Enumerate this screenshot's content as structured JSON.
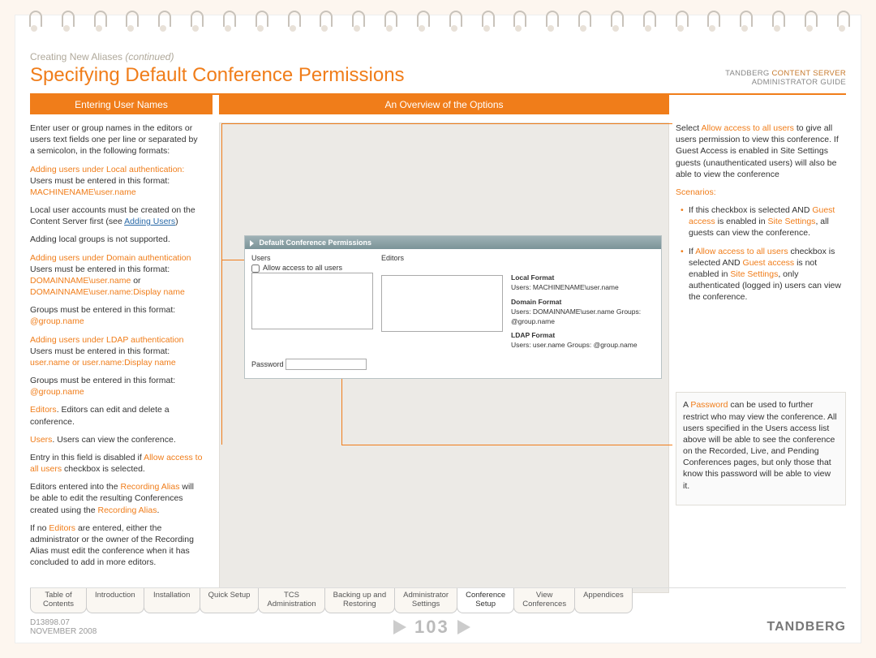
{
  "breadcrumb_main": "Creating New Aliases",
  "breadcrumb_cont": "(continued)",
  "title": "Specifying Default Conference Permissions",
  "doc_line1a": "TANDBERG",
  "doc_line1b": "CONTENT SERVER",
  "doc_line2": "ADMINISTRATOR GUIDE",
  "sh_left": "Entering User Names",
  "sh_mid": "An Overview of the Options",
  "left": {
    "p1": "Enter user or group names in the editors or users text fields one per line or separated by a semicolon, in the following formats:",
    "h1": "Adding users under Local authentication:",
    "p2": "Users must be entered in this format:",
    "f1": "MACHINENAME\\user.name",
    "p3a": "Local user accounts must be created on the Content Server first (see ",
    "p3b": "Adding Users",
    "p3c": ")",
    "p4": "Adding local groups is not supported.",
    "h2": "Adding users under Domain authentication",
    "p5a": "Users must be entered in this format: ",
    "p5b": "DOMAINNAME\\user.name",
    "p5c": " or ",
    "p5d": "DOMAINNAME\\user.name:Display name",
    "p6a": "Groups must be entered in this format: ",
    "p6b": "@group.name",
    "h3": "Adding users under LDAP authentication",
    "p7a": "Users must be entered in this format: ",
    "p7b": "user.name or user.name:Display name",
    "p8a": "Groups must be entered in this format: ",
    "p8b": "@group.name",
    "p9a": "Editors",
    "p9b": ". Editors can edit and delete a conference.",
    "p10a": "Users",
    "p10b": ". Users can view the conference.",
    "p11a": "Entry in this field is disabled if ",
    "p11b": "Allow access to all users",
    "p11c": " checkbox is selected.",
    "p12a": "Editors entered into the ",
    "p12b": "Recording Alias",
    "p12c": " will be able to edit the resulting Conferences created using the ",
    "p12d": "Recording Alias",
    "p12e": ".",
    "p13a": "If no ",
    "p13b": "Editors",
    "p13c": " are entered, either the administrator or the owner of the Recording Alias must edit the conference when it has concluded to add in more editors."
  },
  "right": {
    "p1a": "Select ",
    "p1b": "Allow access to all users",
    "p1c": " to give all users permission to view this conference. If Guest Access is enabled in Site Settings guests (unauthenticated users) will also be able to view the conference",
    "h1": "Scenarios:",
    "li1a": "If this checkbox is selected AND ",
    "li1b": "Guest access",
    "li1c": " is enabled in ",
    "li1d": "Site Settings",
    "li1e": ", all guests can view the conference.",
    "li2a": "If ",
    "li2b": "Allow access to all users",
    "li2c": " checkbox is selected AND ",
    "li2d": "Guest access",
    "li2e": " is not enabled in ",
    "li2f": "Site Settings",
    "li2g": ", only authenticated (logged in) users can view the conference.",
    "pw_a": "A ",
    "pw_b": "Password",
    "pw_c": " can be used to further restrict who may view the conference. All users specified in the Users access list above will be able to see the conference on the Recorded, Live, and Pending Conferences pages, but only those that know this password will be able to view it."
  },
  "ss": {
    "title": "Default Conference Permissions",
    "users": "Users",
    "editors": "Editors",
    "allow": "Allow access to all users",
    "lf": "Local Format",
    "lf_u": "Users: MACHINENAME\\user.name",
    "df": "Domain Format",
    "df_u": "Users: DOMAINNAME\\user.name  Groups: @group.name",
    "ldf": "LDAP Format",
    "ldf_u": "Users: user.name  Groups: @group.name",
    "pw": "Password"
  },
  "tabs": [
    "Table of\nContents",
    "Introduction",
    "Installation",
    "Quick Setup",
    "TCS\nAdministration",
    "Backing up and\nRestoring",
    "Administrator\nSettings",
    "Conference\nSetup",
    "View\nConferences",
    "Appendices"
  ],
  "active_tab_index": 7,
  "doc_id": "D13898.07",
  "doc_date": "NOVEMBER 2008",
  "page_num": "103",
  "brand": "TANDBERG"
}
